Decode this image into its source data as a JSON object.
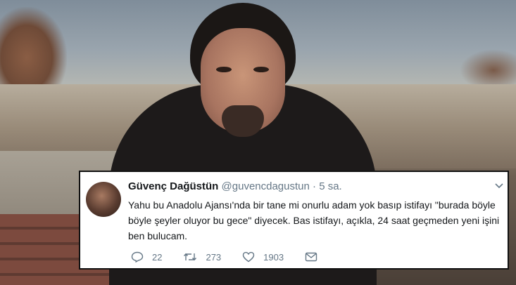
{
  "tweet": {
    "author": {
      "name": "Güvenç Dağüstün",
      "handle": "@guvencdagustun"
    },
    "separator": "·",
    "time": "5 sa.",
    "text": "Yahu bu Anadolu Ajansı'nda bir tane mi onurlu adam yok basıp istifayı \"burada böyle böyle şeyler oluyor bu gece\" diyecek. Bas istifayı, açıkla, 24 saat geçmeden yeni işini ben bulucam.",
    "stats": {
      "replies": "22",
      "retweets": "273",
      "likes": "1903"
    }
  },
  "icons": [
    "reply-icon",
    "retweet-icon",
    "like-icon",
    "message-icon",
    "chevron-down-icon"
  ],
  "colors": {
    "text": "#14171a",
    "muted": "#657786",
    "background": "#ffffff"
  }
}
